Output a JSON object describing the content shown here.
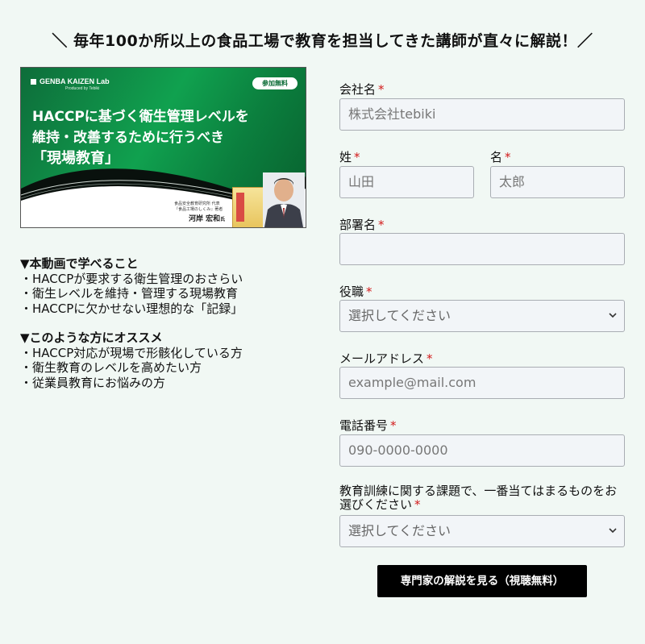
{
  "headline": "＼ 毎年100か所以上の食品工場で教育を担当してきた講師が直々に解説！／",
  "banner": {
    "brand": "GENBA KAIZEN Lab",
    "brand_sub": "Produced by Tebiki",
    "badge": "参加無料",
    "title_line1": "HACCPに基づく衛生管理レベルを",
    "title_line2": "維持・改善するために行うべき",
    "title_line3": "「現場教育」",
    "speaker_affil1": "食品安全教育研究所 代表",
    "speaker_affil2": "『食品工場のしくみ』著者",
    "speaker_name": "河岸 宏和",
    "speaker_suffix": "氏"
  },
  "info": {
    "learn_heading": "▼本動画で学べること",
    "learn_items": [
      "・HACCPが要求する衛生管理のおさらい",
      "・衛生レベルを維持・管理する現場教育",
      "・HACCPに欠かせない理想的な「記録」"
    ],
    "recommend_heading": "▼このような方にオススメ",
    "recommend_items": [
      "・HACCP対応が現場で形骸化している方",
      "・衛生教育のレベルを高めたい方",
      "・従業員教育にお悩みの方"
    ]
  },
  "form": {
    "required_mark": "*",
    "company_label": "会社名",
    "company_placeholder": "株式会社tebiki",
    "last_name_label": "姓",
    "last_name_placeholder": "山田",
    "first_name_label": "名",
    "first_name_placeholder": "太郎",
    "department_label": "部署名",
    "department_placeholder": "",
    "position_label": "役職",
    "position_value": "選択してください",
    "email_label": "メールアドレス",
    "email_placeholder": "example@mail.com",
    "phone_label": "電話番号",
    "phone_placeholder": "090-0000-0000",
    "issue_label_line1": "教育訓練に関する課題で、一番当てはまるものをお",
    "issue_label_line2": "選びください",
    "issue_value": "選択してください",
    "submit_label": "専門家の解説を見る（視聴無料）"
  },
  "colors": {
    "background": "#f1f8f4",
    "required": "#d21a1a",
    "button": "#000000",
    "banner_green": "#10a14f"
  },
  "icons": [
    "chevron-down-icon"
  ]
}
